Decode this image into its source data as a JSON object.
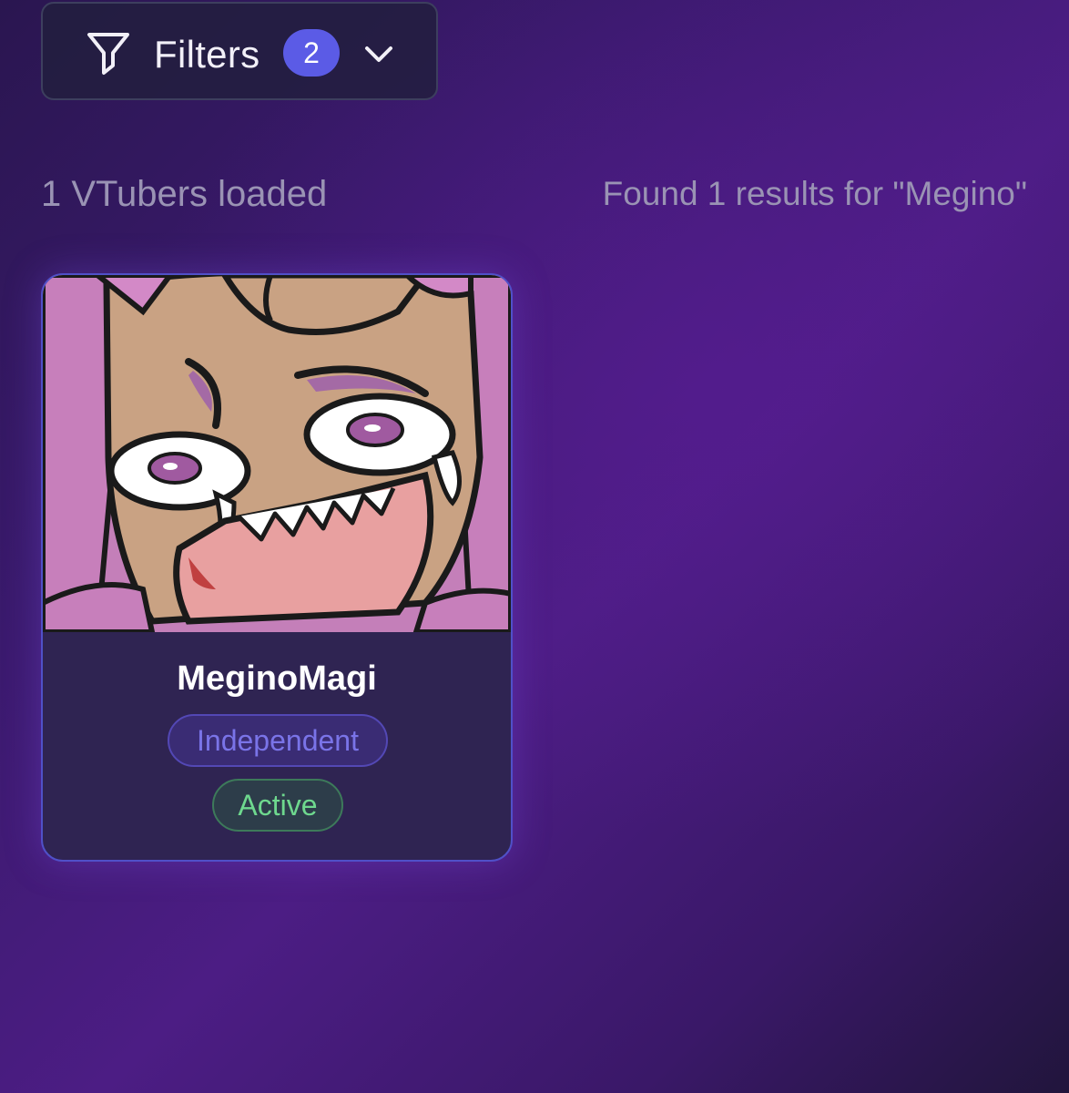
{
  "filters": {
    "label": "Filters",
    "active_count": "2",
    "icon": "funnel-icon",
    "toggle_icon": "chevron-down-icon",
    "count_badge_color": "#5b5be6"
  },
  "summary": {
    "loaded_text": "1 VTubers loaded",
    "results_text": "Found 1 results for \"Megino\""
  },
  "results": [
    {
      "name": "MeginoMagi",
      "affiliation": "Independent",
      "status": "Active",
      "affiliation_color": "#7a74e8",
      "status_color": "#6ed88e"
    }
  ],
  "theme": {
    "card_border": "#5050c8",
    "background_accent": "#4c1d84"
  }
}
